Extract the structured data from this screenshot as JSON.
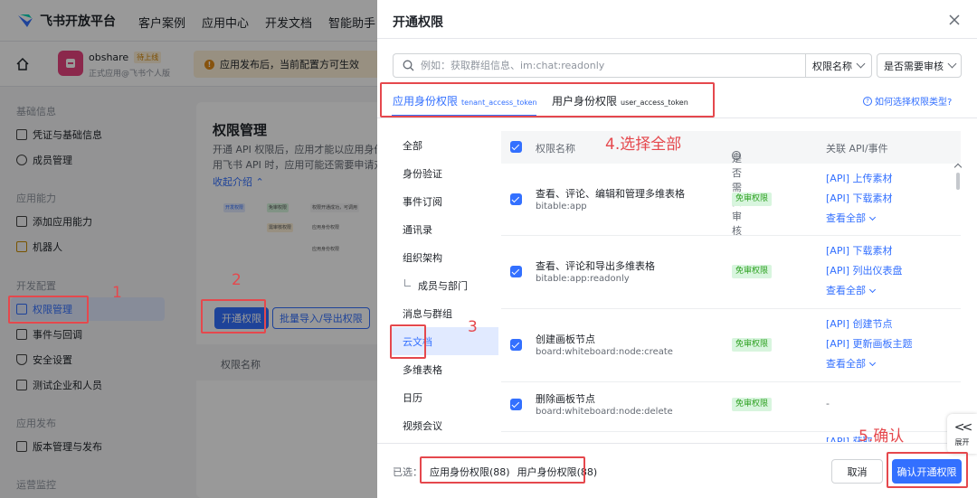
{
  "background": {
    "logo_text": "飞书开放平台",
    "top_nav": [
      "客户案例",
      "应用中心",
      "开发文档",
      "智能助手"
    ],
    "app_name": "obshare",
    "app_status": "待上线",
    "app_sub": "正式应用@飞书个人版",
    "notice": "应用发布后，当前配置方可生效",
    "sidebar": [
      {
        "section": "基础信息",
        "items": [
          "凭证与基础信息",
          "成员管理"
        ]
      },
      {
        "section": "应用能力",
        "items": [
          "添加应用能力",
          "机器人"
        ]
      },
      {
        "section": "开发配置",
        "items": [
          "权限管理",
          "事件与回调",
          "安全设置",
          "测试企业和人员"
        ]
      },
      {
        "section": "应用发布",
        "items": [
          "版本管理与发布"
        ]
      },
      {
        "section": "运营监控",
        "items": []
      }
    ],
    "main_title": "权限管理",
    "main_desc_1": "开通 API 权限后，应用才能以应用身份",
    "main_desc_2": "用飞书 API 时，应用可能还需要申请对",
    "collapse_link": "收起介绍",
    "diagram_labels": [
      "开发权限",
      "免审权限",
      "权限开通成功，可调用",
      "需审核权限",
      "应用身份权限",
      "应用身份权限"
    ],
    "open_btn": "开通权限",
    "batch_btn": "批量导入/导出权限",
    "table_header": "权限名称"
  },
  "drawer": {
    "title": "开通权限",
    "search_placeholder": "例如：获取群组信息、im:chat:readonly",
    "filter_name": "权限名称",
    "filter_review": "是否需要审核",
    "tabs": [
      {
        "label": "应用身份权限",
        "sub": "tenant_access_token"
      },
      {
        "label": "用户身份权限",
        "sub": "user_access_token"
      }
    ],
    "help_link": "如何选择权限类型?",
    "categories": [
      "全部",
      "身份验证",
      "事件订阅",
      "通讯录",
      "组织架构",
      "成员与部门",
      "消息与群组",
      "云文档",
      "多维表格",
      "日历",
      "视频会议"
    ],
    "columns": {
      "name": "权限名称",
      "review": "是否需要审核",
      "api": "关联 API/事件"
    },
    "rows": [
      {
        "name": "查看、评论、编辑和管理多维表格",
        "code": "bitable:app",
        "badge": "免审权限",
        "apis": [
          "[API] 上传素材",
          "[API] 下载素材"
        ],
        "more": "查看全部"
      },
      {
        "name": "查看、评论和导出多维表格",
        "code": "bitable:app:readonly",
        "badge": "免审权限",
        "apis": [
          "[API] 下载素材",
          "[API] 列出仪表盘"
        ],
        "more": "查看全部"
      },
      {
        "name": "创建画板节点",
        "code": "board:whiteboard:node:create",
        "badge": "免审权限",
        "apis": [
          "[API] 创建节点",
          "[API] 更新画板主题"
        ],
        "more": "查看全部"
      },
      {
        "name": "删除画板节点",
        "code": "board:whiteboard:node:delete",
        "badge": "免审权限",
        "apis": [
          "-"
        ],
        "more": ""
      }
    ],
    "cut_text": "[API] 获取...",
    "selected_label": "已选：",
    "selected_app": "应用身份权限(88)",
    "selected_user": "用户身份权限(88)",
    "cancel": "取消",
    "confirm": "确认开通权限",
    "expand_label": "展开"
  },
  "annotations": {
    "n1": "1",
    "n2": "2",
    "n3": "3",
    "select_all": "4.选择全部",
    "confirm_note": "5.确认"
  },
  "colors": {
    "accent": "#3370ff",
    "annotation": "#e5484d",
    "badge_bg": "#d8f5de",
    "badge_text": "#2ea121"
  }
}
